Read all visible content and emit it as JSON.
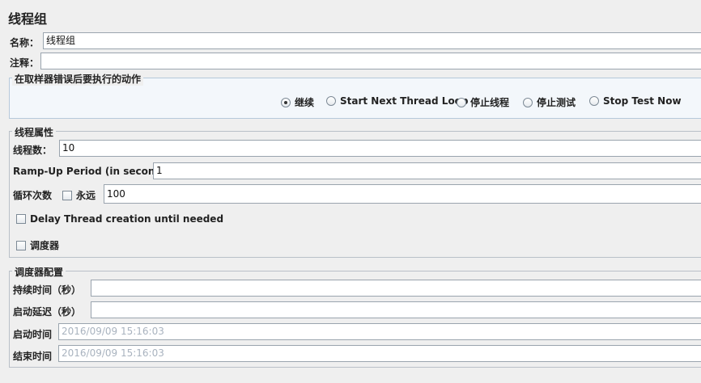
{
  "panel": {
    "title": "线程组"
  },
  "name_field": {
    "label": "名称：",
    "value": "线程组"
  },
  "comment_field": {
    "label": "注释：",
    "value": ""
  },
  "error_action": {
    "legend": "在取样器错误后要执行的动作",
    "options": [
      {
        "label": "继续",
        "selected": true
      },
      {
        "label": "Start Next Thread Loop",
        "selected": false
      },
      {
        "label": "停止线程",
        "selected": false
      },
      {
        "label": "停止测试",
        "selected": false
      },
      {
        "label": "Stop Test Now",
        "selected": false
      }
    ]
  },
  "thread_props": {
    "legend": "线程属性",
    "thread_count": {
      "label": "线程数：",
      "value": "10"
    },
    "ramp_up": {
      "label": "Ramp-Up Period (in seconds):",
      "value": "1"
    },
    "loop": {
      "label": "循环次数",
      "forever_label": "永远",
      "forever_checked": false,
      "value": "100"
    },
    "delay_creation": {
      "label": "Delay Thread creation until needed",
      "checked": false
    },
    "scheduler": {
      "label": "调度器",
      "checked": false
    }
  },
  "scheduler_config": {
    "legend": "调度器配置",
    "duration": {
      "label": "持续时间（秒）",
      "value": ""
    },
    "startup_delay": {
      "label": "启动延迟（秒）",
      "value": ""
    },
    "start_time": {
      "label": "启动时间",
      "value": "2016/09/09 15:16:03"
    },
    "end_time": {
      "label": "结束时间",
      "value": "2016/09/09 15:16:03"
    }
  }
}
